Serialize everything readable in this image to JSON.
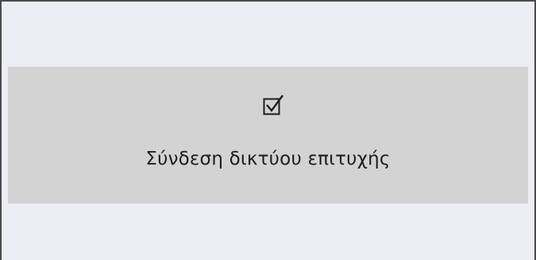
{
  "notification": {
    "icon": "checkbox-checked-icon",
    "message": "Σύνδεση δικτύου επιτυχής"
  },
  "colors": {
    "background": "#edeef3",
    "band": "#d3d3d3",
    "text": "#1e1e1e",
    "border": "#4a4a4a"
  }
}
